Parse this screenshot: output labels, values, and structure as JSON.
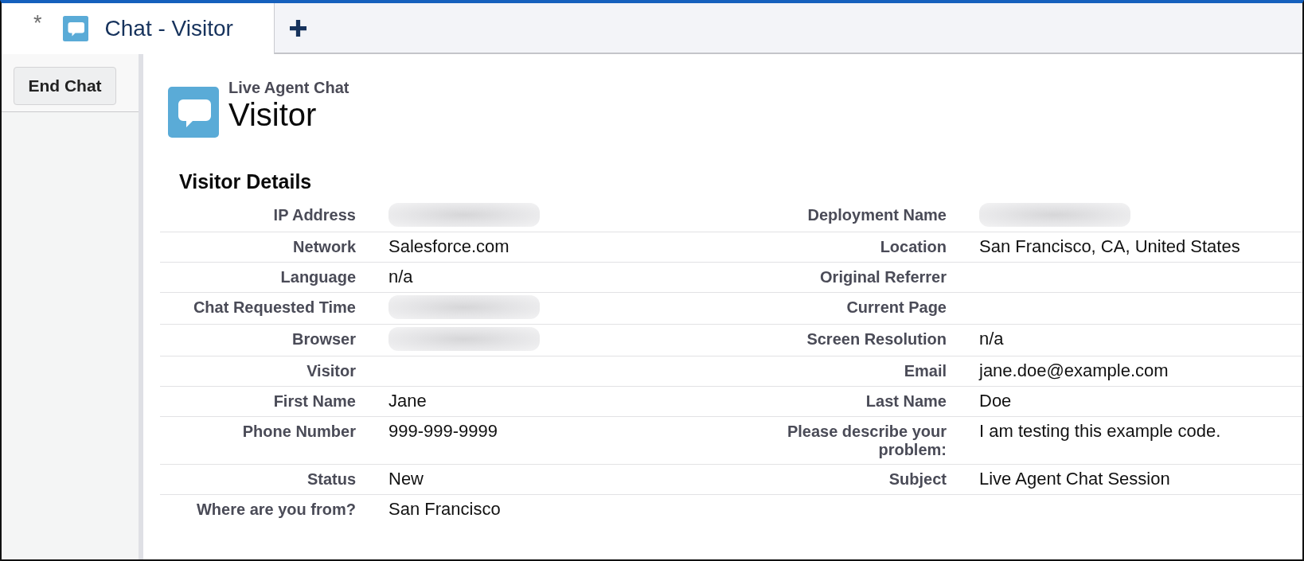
{
  "tabs": [
    {
      "modified_mark": "*",
      "label": "Chat - Visitor",
      "selected": true
    }
  ],
  "sidebar": {
    "button": "End Chat"
  },
  "header": {
    "caption": "Live Agent Chat",
    "title": "Visitor"
  },
  "visitor_details": {
    "title": "Visitor Details",
    "rows": [
      {
        "fields": [
          {
            "label": "IP Address",
            "redacted": true
          },
          {
            "label": "Deployment Name",
            "redacted": true
          }
        ]
      },
      {
        "fields": [
          {
            "label": "Network",
            "value": "Salesforce.com",
            "redacted": false
          },
          {
            "label": "Location",
            "value": "San Francisco, CA, United States",
            "redacted": false
          }
        ]
      },
      {
        "fields": [
          {
            "label": "Language",
            "value": "n/a",
            "redacted": false
          },
          {
            "label": "Original Referrer",
            "redacted": false
          }
        ]
      },
      {
        "fields": [
          {
            "label": "Chat Requested Time",
            "redacted": true
          },
          {
            "label": "Current Page",
            "redacted": false
          }
        ]
      },
      {
        "fields": [
          {
            "label": "Browser",
            "redacted": true
          },
          {
            "label": "Screen Resolution",
            "value": "n/a",
            "redacted": false
          }
        ]
      },
      {
        "fields": [
          {
            "label": "Visitor",
            "redacted": false
          },
          {
            "label": "Email",
            "value": "jane.doe@example.com",
            "redacted": false
          }
        ]
      },
      {
        "fields": [
          {
            "label": "First Name",
            "value": "Jane",
            "redacted": false
          },
          {
            "label": "Last Name",
            "value": "Doe",
            "redacted": false
          }
        ]
      },
      {
        "fields": [
          {
            "label": "Phone Number",
            "value": "999-999-9999",
            "redacted": false
          },
          {
            "label": "Please describe your problem:",
            "value": "I am testing this example code.",
            "redacted": false
          }
        ]
      },
      {
        "fields": [
          {
            "label": "Status",
            "value": "New",
            "redacted": false
          },
          {
            "label": "Subject",
            "value": "Live Agent Chat Session",
            "redacted": false
          }
        ]
      },
      {
        "fields": [
          {
            "label": "Where are you from?",
            "value": "San Francisco",
            "redacted": false
          }
        ]
      }
    ]
  }
}
